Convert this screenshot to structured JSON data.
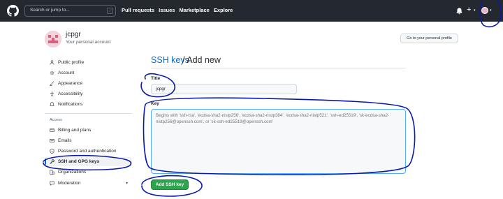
{
  "header": {
    "search_placeholder": "Search or jump to...",
    "search_shortcut": "/",
    "nav": [
      "Pull requests",
      "Issues",
      "Marketplace",
      "Explore"
    ],
    "plus_label": "+",
    "caret": "▾"
  },
  "profile": {
    "name": "jcpgr",
    "subtitle": "Your personal account",
    "button": "Go to your personal profile"
  },
  "sidebar": {
    "items": [
      {
        "label": "Public profile",
        "icon": "person-icon"
      },
      {
        "label": "Account",
        "icon": "gear-icon"
      },
      {
        "label": "Appearance",
        "icon": "paintbrush-icon"
      },
      {
        "label": "Accessibility",
        "icon": "accessibility-icon"
      },
      {
        "label": "Notifications",
        "icon": "bell-icon"
      }
    ],
    "access_heading": "Access",
    "access_items": [
      {
        "label": "Billing and plans",
        "icon": "credit-card-icon"
      },
      {
        "label": "Emails",
        "icon": "mail-icon"
      },
      {
        "label": "Password and authentication",
        "icon": "shield-lock-icon"
      },
      {
        "label": "SSH and GPG keys",
        "icon": "key-icon",
        "selected": true
      },
      {
        "label": "Organizations",
        "icon": "organization-icon"
      },
      {
        "label": "Moderation",
        "icon": "report-icon",
        "expandable": true
      }
    ]
  },
  "main": {
    "title_link": "SSH keys",
    "title_rest": "/ Add new",
    "title_label": "Title",
    "title_value": "jcpgr",
    "key_label": "Key",
    "key_placeholder": "Begins with 'ssh-rsa', 'ecdsa-sha2-nistp256', 'ecdsa-sha2-nistp384', 'ecdsa-sha2-nistp521', 'ssh-ed25519', 'sk-ecdsa-sha2-nistp256@openssh.com', or 'sk-ssh-ed25519@openssh.com'",
    "submit_label": "Add SSH key"
  },
  "colors": {
    "header_bg": "#24292f",
    "link": "#0969da",
    "primary_button": "#2da44e",
    "annotation_ink": "#0a1aa8"
  }
}
